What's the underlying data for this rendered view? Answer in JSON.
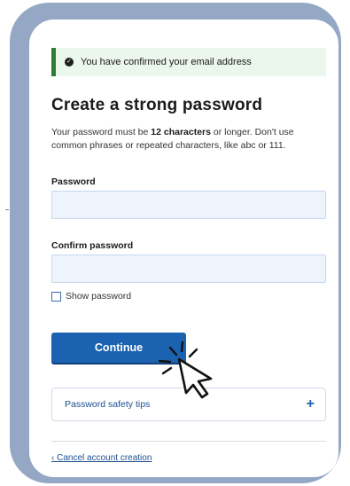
{
  "alert": {
    "message": "You have confirmed your email address"
  },
  "page": {
    "title": "Create a strong password",
    "desc_before": "Your password must be ",
    "desc_bold": "12 characters",
    "desc_after": " or longer. Don't use common phrases or repeated characters, like abc or 111."
  },
  "form": {
    "password_label": "Password",
    "password_value": "",
    "confirm_label": "Confirm password",
    "confirm_value": "",
    "show_password_label": "Show password",
    "show_password_checked": false
  },
  "actions": {
    "continue_label": "Continue",
    "tips_label": "Password safety tips",
    "tips_icon": "+",
    "cancel_label": "Cancel account creation"
  },
  "colors": {
    "frame": "#94a8c6",
    "primary": "#1b62b0",
    "success": "#2e7d32",
    "field_bg": "#eef4fc"
  }
}
